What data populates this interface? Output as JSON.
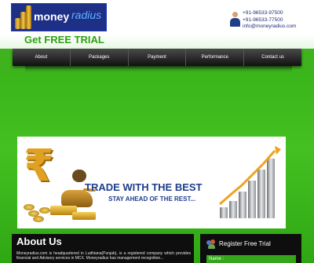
{
  "header": {
    "logo_word1": "money",
    "logo_word2": "radius",
    "trial_text": "Get FREE TRIAL",
    "phone1": "+91-96533-97500",
    "phone2": "+91-96533-77500",
    "email": "info@moneyradius.com"
  },
  "nav": {
    "items": [
      "About",
      "Packages",
      "Payment",
      "Performance",
      "Contact us"
    ]
  },
  "banner": {
    "symbol": "₹",
    "headline": "TRADE WITH THE BEST",
    "subline": "STAY AHEAD OF THE  REST..."
  },
  "about": {
    "title": "About Us",
    "text": "Moneyradius.com is headquartered in Ludhiana(Punjab), is a registered company which provides financial and Advisory services in MCX. Moneyradius has management recognition..."
  },
  "register": {
    "title": "Register Free Trial",
    "name_label": "Name :"
  },
  "colors": {
    "brand_green": "#3fb31e",
    "brand_blue": "#1e2f86",
    "headline_blue": "#1e3d8d",
    "trial_green": "#2ca20f"
  }
}
